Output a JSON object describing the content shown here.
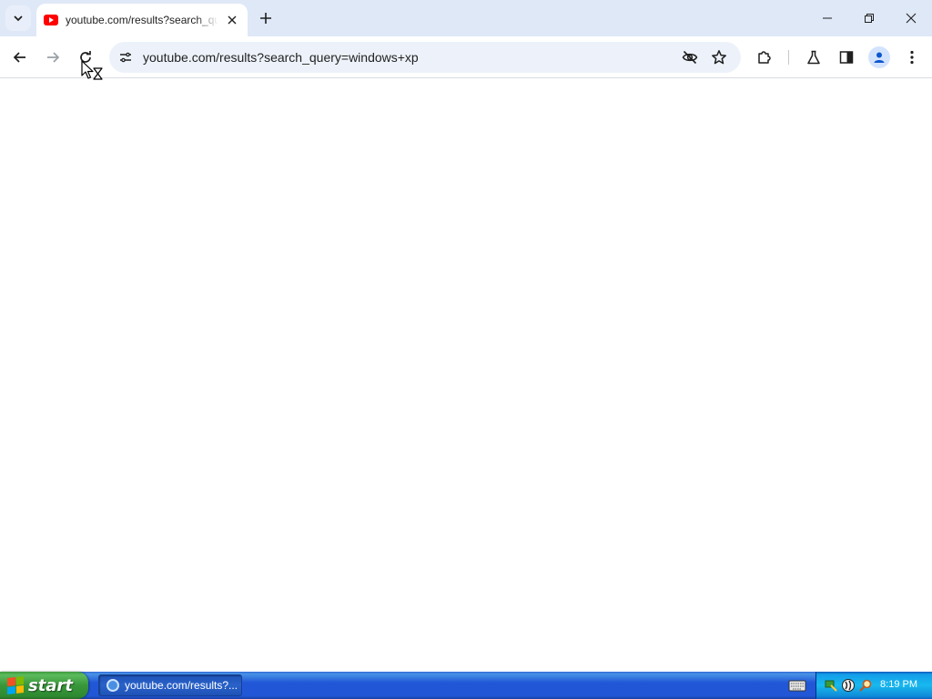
{
  "browser": {
    "tab": {
      "title": "youtube.com/results?search_query=windows+xp"
    },
    "address_bar": {
      "url": "youtube.com/results?search_query=windows+xp"
    }
  },
  "taskbar": {
    "start_label": "start",
    "task_button_label": "youtube.com/results?...",
    "clock": "8:19 PM"
  },
  "colors": {
    "tab_strip": "#dfe8f7",
    "omnibox": "#edf2fa",
    "youtube_red": "#ff0000",
    "taskbar_blue": "#2157d7",
    "start_green": "#38963a",
    "tray_blue": "#18b9ef"
  },
  "icons": {
    "tab_search": "chevron-down-icon",
    "tab_close": "close-icon",
    "new_tab": "plus-icon",
    "back": "back-arrow-icon",
    "forward": "forward-arrow-icon",
    "reload": "reload-icon",
    "site_info": "tune-icon",
    "tracking": "eye-slash-icon",
    "bookmark": "star-icon",
    "extensions": "puzzle-icon",
    "labs": "flask-icon",
    "side_panel": "side-panel-icon",
    "profile": "person-icon",
    "menu": "kebab-menu-icon"
  }
}
